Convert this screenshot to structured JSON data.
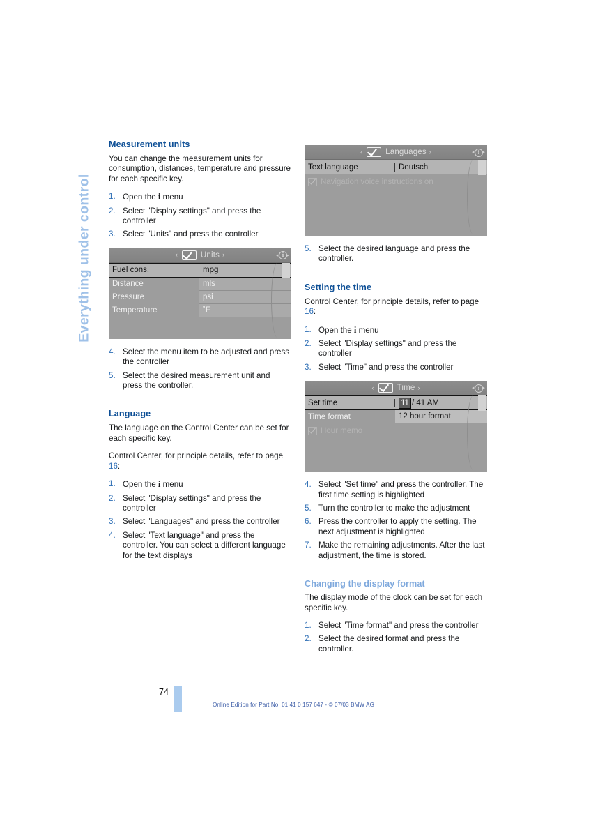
{
  "chapter_tab": {
    "label": "Everything under control"
  },
  "left_column": {
    "measurement_units": {
      "heading": "Measurement units",
      "intro": "You can change the measurement units for consumption, distances, temperature and pressure for each specific key.",
      "steps": [
        {
          "num": "1.",
          "text_before": "Open the ",
          "icon": "i",
          "text_after": " menu"
        },
        {
          "num": "2.",
          "text": "Select \"Display settings\" and press the controller"
        },
        {
          "num": "3.",
          "text": "Select \"Units\" and press the controller"
        }
      ],
      "steps_after": [
        {
          "num": "4.",
          "text": "Select the menu item to be adjusted and press the controller"
        },
        {
          "num": "5.",
          "text": "Select the desired measurement unit and press the controller."
        }
      ]
    },
    "units_display": {
      "figure_id": "MN0085LRA",
      "title": "Units",
      "title_icon": "checkbox-check-icon",
      "left_arrow": "‹",
      "right_arrow": "›",
      "info_icon_letter": "i",
      "rows": [
        {
          "label": "Fuel cons.",
          "value": "mpg",
          "selected": true
        },
        {
          "label": "Distance",
          "value": "mls",
          "selected": false
        },
        {
          "label": "Pressure",
          "value": "psi",
          "selected": false
        },
        {
          "label": "Temperature",
          "value": "˚F",
          "selected": false
        }
      ]
    },
    "language": {
      "heading": "Language",
      "intro": "The language on the Control Center can be set for each specific key.",
      "ref_before": "Control Center, for principle details, refer to page ",
      "ref_page": "16",
      "ref_after": ":",
      "steps": [
        {
          "num": "1.",
          "text_before": "Open the ",
          "icon": "i",
          "text_after": " menu"
        },
        {
          "num": "2.",
          "text": "Select \"Display settings\" and press the controller"
        },
        {
          "num": "3.",
          "text": "Select \"Languages\" and press the controller"
        },
        {
          "num": "4.",
          "text": "Select \"Text language\" and press the controller. You can select a different language for the text displays"
        }
      ]
    }
  },
  "right_column": {
    "languages_display": {
      "figure_id": "MN0086LRA",
      "title": "Languages",
      "title_icon": "checkbox-check-icon",
      "left_arrow": "‹",
      "right_arrow": "›",
      "info_icon_letter": "i",
      "rows": [
        {
          "label": "Text language",
          "value": "Deutsch",
          "selected": true
        }
      ],
      "checkbox_row": {
        "label": "Navigation voice instructions on",
        "checked": true
      }
    },
    "languages_step": {
      "num": "5.",
      "text": "Select the desired language and press the controller."
    },
    "setting_the_time": {
      "heading": "Setting the time",
      "ref_before": "Control Center, for principle details, refer to page ",
      "ref_page": "16",
      "ref_after": ":",
      "steps": [
        {
          "num": "1.",
          "text_before": "Open the ",
          "icon": "i",
          "text_after": " menu"
        },
        {
          "num": "2.",
          "text": "Select \"Display settings\" and press the controller"
        },
        {
          "num": "3.",
          "text": "Select \"Time\" and press the controller"
        }
      ],
      "steps_after": [
        {
          "num": "4.",
          "text": "Select \"Set time\" and press the controller. The first time setting is highlighted"
        },
        {
          "num": "5.",
          "text": "Turn the controller to make the adjustment"
        },
        {
          "num": "6.",
          "text": "Press the controller to apply the setting. The next adjustment is highlighted"
        },
        {
          "num": "7.",
          "text": "Make the remaining adjustments. After the last adjustment, the time is stored."
        }
      ]
    },
    "time_display": {
      "figure_id": "MN0087LRA",
      "title": "Time",
      "title_icon": "checkbox-check-icon",
      "left_arrow": "‹",
      "right_arrow": "›",
      "info_icon_letter": "i",
      "set_time": {
        "label": "Set time",
        "hour": "11",
        "rest": "/ 41 AM"
      },
      "time_format": {
        "label": "Time format",
        "value": "12 hour format"
      },
      "checkbox_row": {
        "label": "Hour memo",
        "checked": true
      }
    },
    "changing_display_format": {
      "heading": "Changing the display format",
      "intro": "The display mode of the clock can be set for each specific key.",
      "steps": [
        {
          "num": "1.",
          "text": "Select \"Time format\" and press the controller"
        },
        {
          "num": "2.",
          "text": "Select the desired format and press the controller."
        }
      ]
    }
  },
  "footer": {
    "page_number": "74",
    "note": "Online Edition for Part No. 01 41 0 157 647 - © 07/03 BMW AG"
  }
}
